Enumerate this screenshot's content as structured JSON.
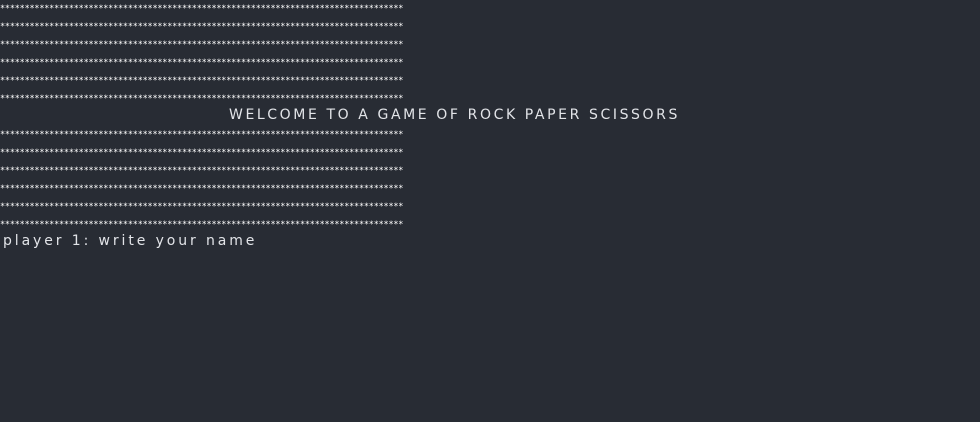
{
  "terminal": {
    "star_row": "**********************************************************************************",
    "welcome_text": "WELCOME TO A GAME OF ROCK PAPER SCISSORS",
    "prompt_text": "player 1: write your name"
  }
}
